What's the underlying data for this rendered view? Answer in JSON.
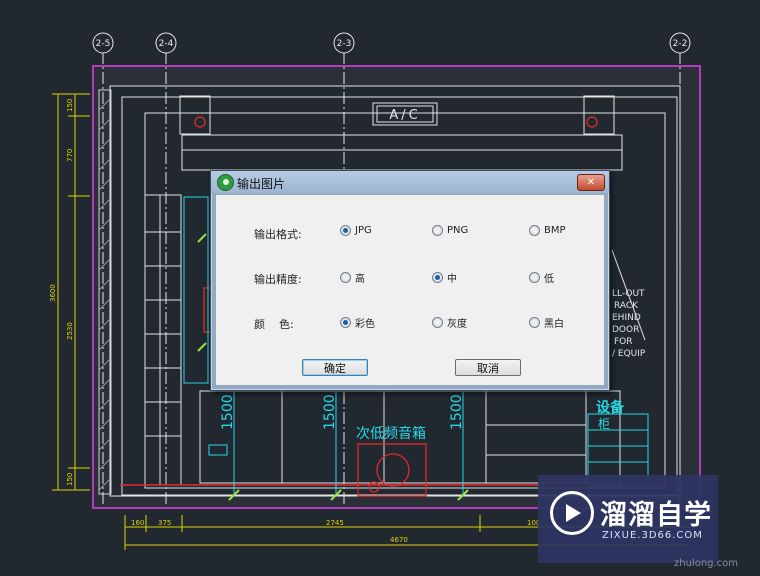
{
  "drawing": {
    "gridlines": [
      "2-5",
      "2-4",
      "2-3",
      "2-2"
    ],
    "ac_label": "A/C",
    "subwoofer_label": "次低频音箱",
    "equipment_label": "设备",
    "equipment_label_2": "柜",
    "side_note": [
      "LL-OUT",
      "RACK",
      "EHIND",
      "DOOR",
      "FOR",
      "/ EQUIP"
    ],
    "dim_1500": "1500",
    "left_dims": [
      "150",
      "770",
      "3600",
      "2530",
      "150"
    ],
    "bottom_dims": [
      "160",
      "375",
      "2745",
      "100"
    ],
    "bottom_total": "4670",
    "colors": {
      "background": "#212830",
      "wall": "#b43bbf",
      "outline": "#e4e4e4",
      "axis": "#e8e8e8",
      "dim_yellow": "#e0d400",
      "cyan": "#27d9e6",
      "red": "#e22a2a",
      "green": "#9be244"
    }
  },
  "dialog": {
    "title": "输出图片",
    "close_icon": "x-icon",
    "rows": [
      {
        "label": "输出格式:",
        "options": [
          "JPG",
          "PNG",
          "BMP"
        ],
        "selected": 0
      },
      {
        "label": "输出精度:",
        "options": [
          "高",
          "中",
          "低"
        ],
        "selected": 1
      },
      {
        "label": "颜    色:",
        "options": [
          "彩色",
          "灰度",
          "黑白"
        ],
        "selected": 0
      }
    ],
    "ok_label": "确定",
    "cancel_label": "取消"
  },
  "logo": {
    "name": "溜溜自学",
    "url": "ZIXUE.3D66.COM",
    "watermark": "zhulong.com"
  }
}
